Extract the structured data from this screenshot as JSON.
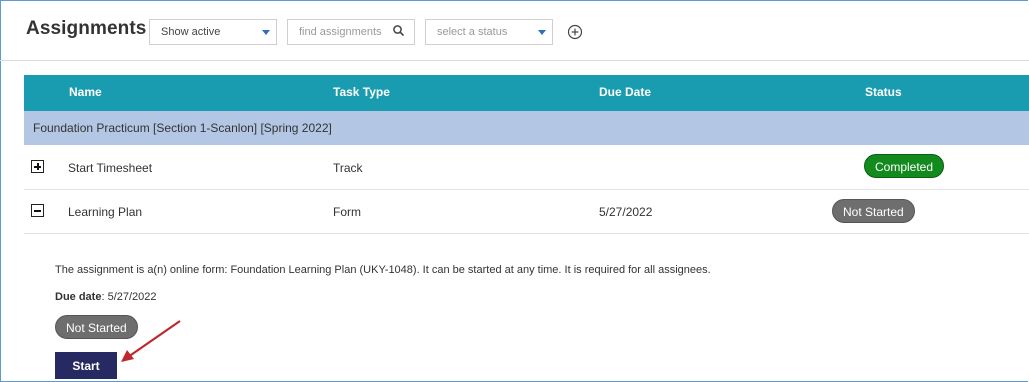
{
  "header": {
    "title": "Assignments",
    "filter_select": {
      "value": "Show active"
    },
    "search": {
      "placeholder": "find assignments"
    },
    "status_select": {
      "placeholder": "select a status"
    },
    "icons": {
      "search": "search-icon",
      "add": "add-circle-icon",
      "dropdown": "chevron-down-icon"
    },
    "accent_color": "#2f6fb7"
  },
  "table": {
    "columns": [
      "Name",
      "Task Type",
      "Due Date",
      "Status"
    ],
    "header_color": "#1a9cb0",
    "group": {
      "label": "Foundation Practicum [Section 1-Scanlon] [Spring 2022]",
      "color": "#b3c7e4"
    },
    "rows": [
      {
        "expander": "plus",
        "name": "Start Timesheet",
        "task_type": "Track",
        "due_date": "",
        "status": "Completed",
        "status_color": "#138a1e"
      },
      {
        "expander": "minus",
        "name": "Learning Plan",
        "task_type": "Form",
        "due_date": "5/27/2022",
        "status": "Not Started",
        "status_color": "#6e6e6e"
      }
    ]
  },
  "details": {
    "description": "The assignment is a(n) online form: Foundation Learning Plan (UKY-1048). It can be started at any time. It is required for all assignees.",
    "due_label": "Due date",
    "due_value": ": 5/27/2022",
    "status": "Not Started",
    "start_label": "Start",
    "start_color": "#272963"
  },
  "annotation": {
    "arrow_color": "#c0272d",
    "icon": "annotation-arrow"
  }
}
